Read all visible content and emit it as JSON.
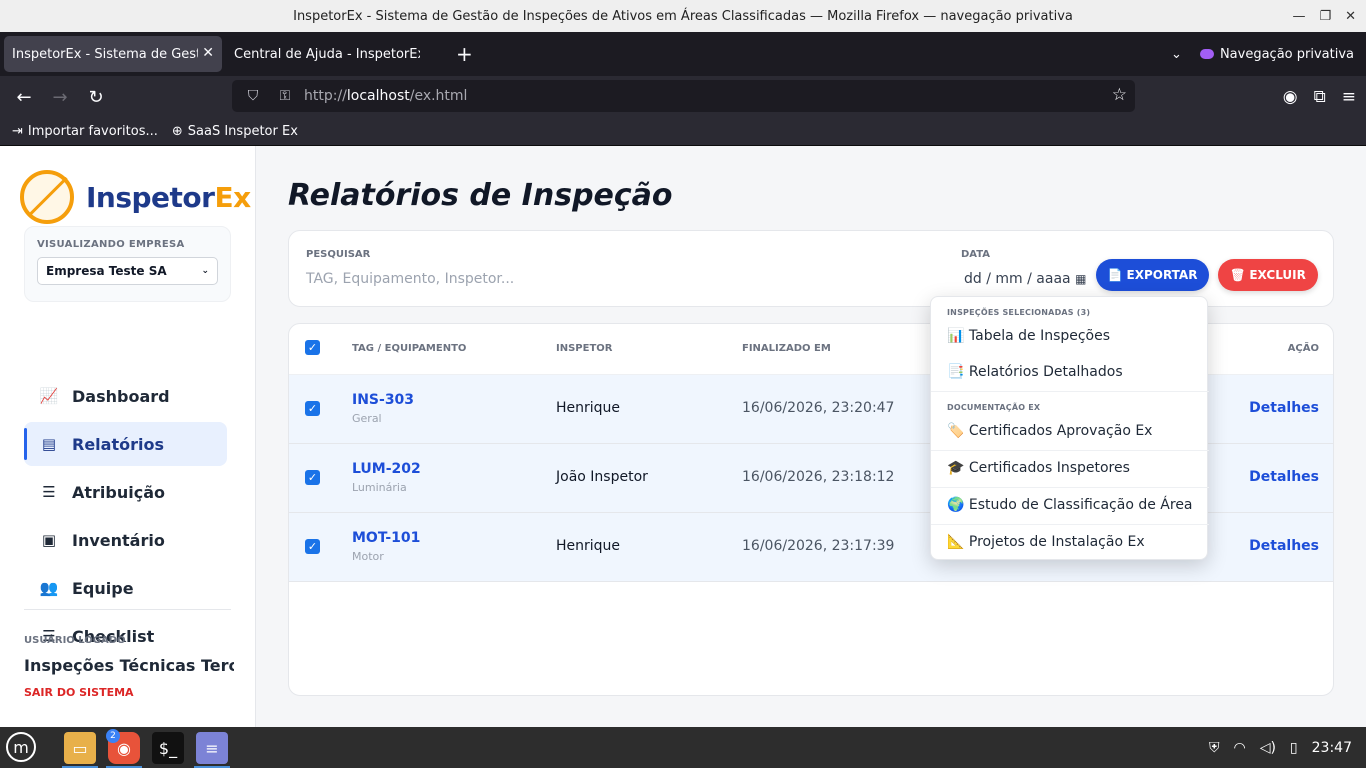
{
  "window": {
    "title": "InspetorEx - Sistema de Gestão de Inspeções de Ativos em Áreas Classificadas — Mozilla Firefox — navegação privativa"
  },
  "browser": {
    "tabs": [
      {
        "label": "InspetorEx - Sistema de Gestão de Inspeções",
        "active": true
      },
      {
        "label": "Central de Ajuda - InspetorEx",
        "active": false
      }
    ],
    "private_label": "Navegação privativa",
    "url_scheme": "http://",
    "url_host": "localhost",
    "url_path": "/ex.html",
    "bookmarks": [
      "Importar favoritos...",
      "SaaS Inspetor Ex"
    ]
  },
  "sidebar": {
    "logo_main": "Inspetor",
    "logo_accent": "Ex",
    "company_label": "VISUALIZANDO EMPRESA",
    "company_value": "Empresa Teste SA",
    "items": [
      {
        "label": "Dashboard",
        "icon": "chart-line-icon"
      },
      {
        "label": "Relatórios",
        "icon": "file-icon",
        "active": true
      },
      {
        "label": "Atribuição",
        "icon": "list-check-icon"
      },
      {
        "label": "Inventário",
        "icon": "boxes-icon"
      },
      {
        "label": "Equipe",
        "icon": "users-icon"
      },
      {
        "label": "Checklist",
        "icon": "list-check-icon"
      }
    ],
    "user_label": "USUÁRIO LOGADO",
    "user_name": "Inspeções Técnicas Terce...",
    "logout": "SAIR DO SISTEMA"
  },
  "main": {
    "title": "Relatórios de Inspeção",
    "search_label": "PESQUISAR",
    "search_placeholder": "TAG, Equipamento, Inspetor...",
    "date_label": "DATA",
    "date_placeholder": "dd / mm / aaaa",
    "export_label": "EXPORTAR",
    "delete_label": "EXCLUIR",
    "columns": [
      "TAG / EQUIPAMENTO",
      "INSPETOR",
      "FINALIZADO EM",
      "AÇÃO"
    ],
    "rows": [
      {
        "tag": "INS-303",
        "type": "Geral",
        "inspector": "Henrique",
        "finished": "16/06/2026, 23:20:47",
        "action": "Detalhes",
        "checked": true
      },
      {
        "tag": "LUM-202",
        "type": "Luminária",
        "inspector": "João Inspetor",
        "finished": "16/06/2026, 23:18:12",
        "action": "Detalhes",
        "checked": true
      },
      {
        "tag": "MOT-101",
        "type": "Motor",
        "inspector": "Henrique",
        "finished": "16/06/2026, 23:17:39",
        "action": "Detalhes",
        "checked": true
      }
    ]
  },
  "export_menu": {
    "section1": "INSPEÇÕES SELECIONADAS (3)",
    "items1": [
      "📊 Tabela de Inspeções",
      "📑 Relatórios Detalhados"
    ],
    "section2": "DOCUMENTAÇÃO EX",
    "items2": [
      "🏷️ Certificados Aprovação Ex",
      "🎓 Certificados Inspetores",
      "🌍 Estudo de Classificação de Área",
      "📐 Projetos de Instalação Ex"
    ]
  },
  "taskbar": {
    "firefox_badge": "2",
    "clock": "23:47"
  },
  "colors": {
    "primary": "#1d4ed8",
    "danger": "#ef4444",
    "accent": "#f59e0b"
  }
}
